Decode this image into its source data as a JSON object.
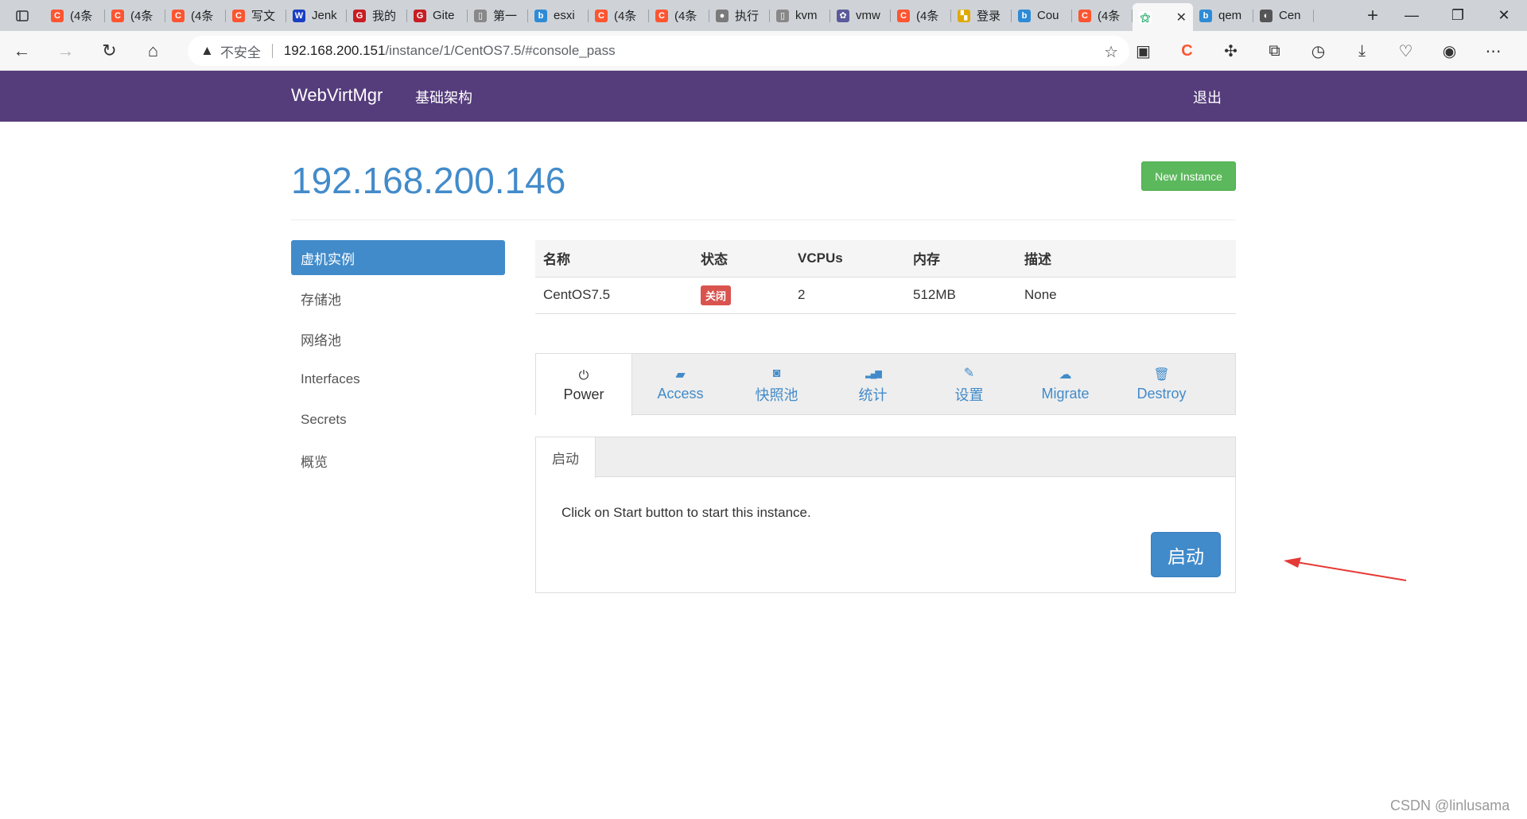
{
  "browser": {
    "tabs": [
      {
        "icon": "csdn-icon",
        "color": "#fc5531",
        "glyph": "C",
        "title": "(4条"
      },
      {
        "icon": "csdn-icon",
        "color": "#fc5531",
        "glyph": "C",
        "title": "(4条"
      },
      {
        "icon": "csdn-icon",
        "color": "#fc5531",
        "glyph": "C",
        "title": "(4条"
      },
      {
        "icon": "csdn-icon",
        "color": "#fc5531",
        "glyph": "C",
        "title": "写文"
      },
      {
        "icon": "w-icon",
        "color": "#1a3fc2",
        "glyph": "W",
        "title": "Jenk"
      },
      {
        "icon": "gitee-icon",
        "color": "#c71d23",
        "glyph": "G",
        "title": "我的"
      },
      {
        "icon": "gitee-icon",
        "color": "#c71d23",
        "glyph": "G",
        "title": "Gite"
      },
      {
        "icon": "page-icon",
        "color": "#888888",
        "glyph": "▯",
        "title": "第一"
      },
      {
        "icon": "bing-icon",
        "color": "#2e8bd6",
        "glyph": "b",
        "title": "esxi"
      },
      {
        "icon": "csdn-icon",
        "color": "#fc5531",
        "glyph": "C",
        "title": "(4条"
      },
      {
        "icon": "csdn-icon",
        "color": "#fc5531",
        "glyph": "C",
        "title": "(4条"
      },
      {
        "icon": "avatar-icon",
        "color": "#7a7a7a",
        "glyph": "●",
        "title": "执行"
      },
      {
        "icon": "page-icon",
        "color": "#888888",
        "glyph": "▯",
        "title": "kvm"
      },
      {
        "icon": "vmware-icon",
        "color": "#5a5a9a",
        "glyph": "✿",
        "title": "vmw"
      },
      {
        "icon": "csdn-icon",
        "color": "#fc5531",
        "glyph": "C",
        "title": "(4条"
      },
      {
        "icon": "puzzle-color-icon",
        "color": "#e0a800",
        "glyph": "▚",
        "title": "登录"
      },
      {
        "icon": "bing-icon",
        "color": "#2e8bd6",
        "glyph": "b",
        "title": "Cou"
      },
      {
        "icon": "csdn-icon",
        "color": "#fc5531",
        "glyph": "C",
        "title": "(4条"
      }
    ],
    "tabs_after": [
      {
        "icon": "bing-icon",
        "color": "#2e8bd6",
        "glyph": "b",
        "title": "qem"
      },
      {
        "icon": "github-icon",
        "color": "#555555",
        "glyph": "◐",
        "title": "Cen"
      }
    ],
    "insecure_label": "不安全",
    "url_host": "192.168.200.151",
    "url_path": "/instance/1/CentOS7.5/#console_pass"
  },
  "app": {
    "brand": "WebVirtMgr",
    "menu_infra": "基础架构",
    "logout": "退出"
  },
  "page": {
    "title": "192.168.200.146",
    "new_instance": "New Instance"
  },
  "sidebar": {
    "items": [
      {
        "label": "虚机实例",
        "active": true
      },
      {
        "label": "存储池"
      },
      {
        "label": "网络池"
      },
      {
        "label": "Interfaces"
      },
      {
        "label": "Secrets"
      },
      {
        "label": "概览"
      }
    ]
  },
  "instance_table": {
    "headers": [
      "名称",
      "状态",
      "VCPUs",
      "内存",
      "描述"
    ],
    "row": {
      "name": "CentOS7.5",
      "status": "关闭",
      "vcpus": "2",
      "memory": "512MB",
      "desc": "None"
    }
  },
  "action_tabs": [
    {
      "label": "Power",
      "icon": "power-icon",
      "glyph": "⏻"
    },
    {
      "label": "Access",
      "icon": "briefcase-icon",
      "glyph": "▰"
    },
    {
      "label": "快照池",
      "icon": "camera-icon",
      "glyph": "◙"
    },
    {
      "label": "统计",
      "icon": "bar-chart-icon",
      "glyph": "▂▄▆"
    },
    {
      "label": "设置",
      "icon": "wrench-icon",
      "glyph": "✎"
    },
    {
      "label": "Migrate",
      "icon": "cloud-upload-icon",
      "glyph": "☁"
    },
    {
      "label": "Destroy",
      "icon": "trash-icon",
      "glyph": "🗑"
    }
  ],
  "power_panel": {
    "tab_label": "启动",
    "message": "Click on Start button to start this instance.",
    "start_button": "启动"
  },
  "watermark": "CSDN @linlusama",
  "colors": {
    "navbar": "#553c7b",
    "primary": "#428bca",
    "success": "#5cb85c",
    "danger": "#d9534f",
    "annotation_arrow": "#e53935"
  }
}
